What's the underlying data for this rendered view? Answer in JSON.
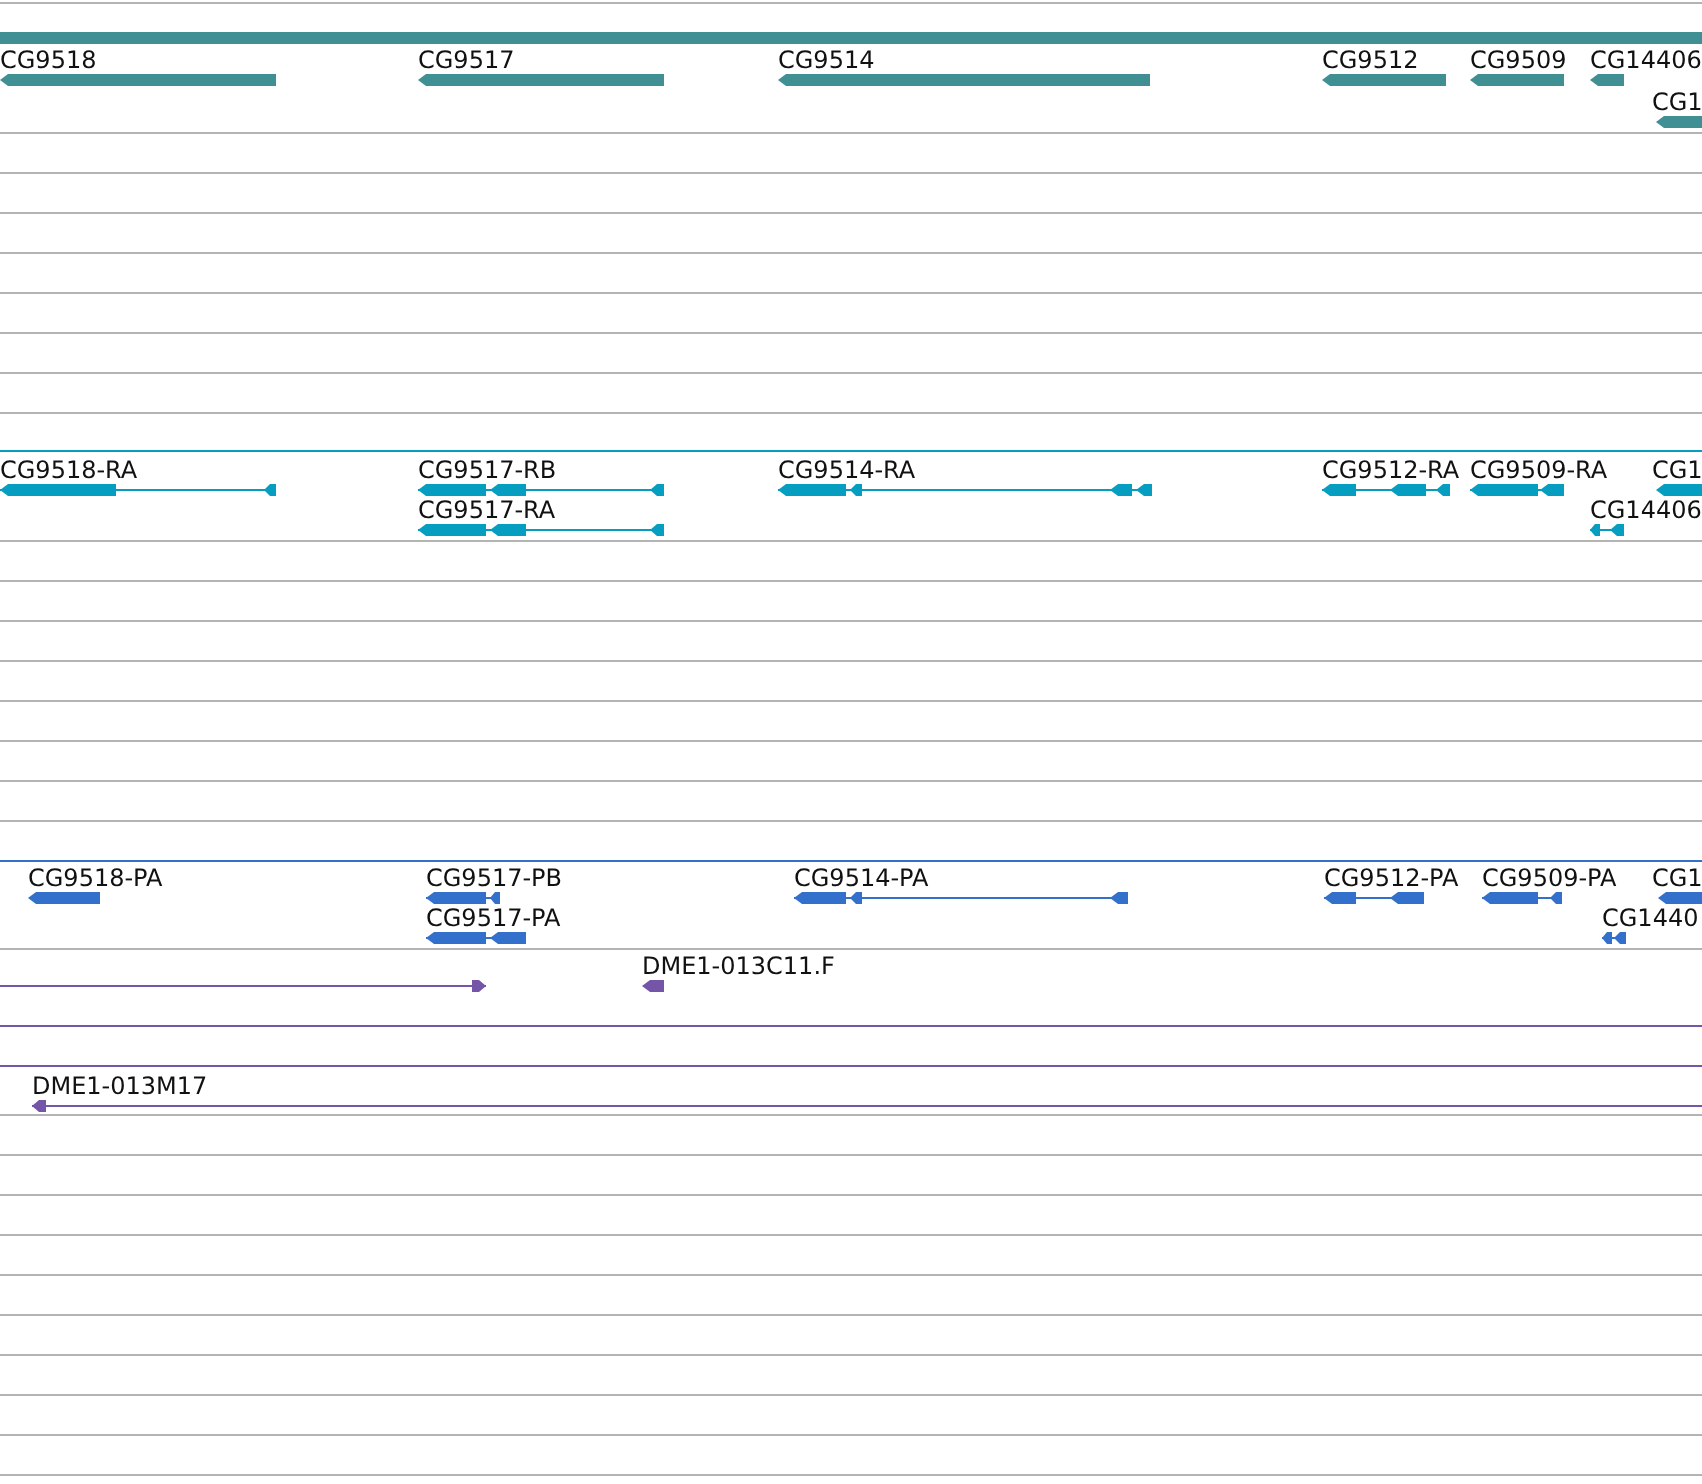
{
  "tracks": [
    {
      "color": "#3f8f93",
      "features": [
        {
          "kind": "block"
        },
        {
          "label": "CG9518",
          "kind": "reverse"
        },
        {
          "label": "CG9517",
          "kind": "reverse"
        },
        {
          "label": "CG9514",
          "kind": "reverse"
        },
        {
          "label": "CG9512",
          "kind": "reverse"
        },
        {
          "label": "CG9509",
          "kind": "reverse"
        },
        {
          "label": "CG14406",
          "kind": "reverse"
        },
        {
          "label": "CG1",
          "kind": "reverse"
        }
      ]
    },
    {
      "color": "#069ec0",
      "features": [
        {
          "label": "CG9518-RA",
          "kind": "reverse"
        },
        {
          "label": "CG9517-RB",
          "kind": "reverse"
        },
        {
          "label": "CG9517-RA",
          "kind": "reverse"
        },
        {
          "label": "CG9514-RA",
          "kind": "reverse"
        },
        {
          "label": "CG9512-RA",
          "kind": "reverse"
        },
        {
          "label": "CG9509-RA",
          "kind": "reverse"
        },
        {
          "label": "CG14406",
          "kind": "reverse"
        },
        {
          "label": "CG1",
          "kind": "reverse"
        }
      ]
    },
    {
      "color": "#3370cc",
      "features": [
        {
          "label": "CG9518-PA",
          "kind": "reverse"
        },
        {
          "label": "CG9517-PB",
          "kind": "reverse"
        },
        {
          "label": "CG9517-PA",
          "kind": "reverse"
        },
        {
          "label": "CG9514-PA",
          "kind": "reverse"
        },
        {
          "label": "CG9512-PA",
          "kind": "reverse"
        },
        {
          "label": "CG9509-PA",
          "kind": "reverse"
        },
        {
          "label": "CG1440",
          "kind": "reverse"
        },
        {
          "label": "CG1",
          "kind": "reverse"
        }
      ]
    },
    {
      "color": "#7455a8",
      "features": [
        {
          "kind": "forward"
        },
        {
          "label": "DME1-013C11.F",
          "kind": "reverse"
        },
        {
          "kind": "block"
        },
        {
          "kind": "block"
        },
        {
          "label": "DME1-013M17",
          "kind": "reverse"
        }
      ]
    }
  ]
}
